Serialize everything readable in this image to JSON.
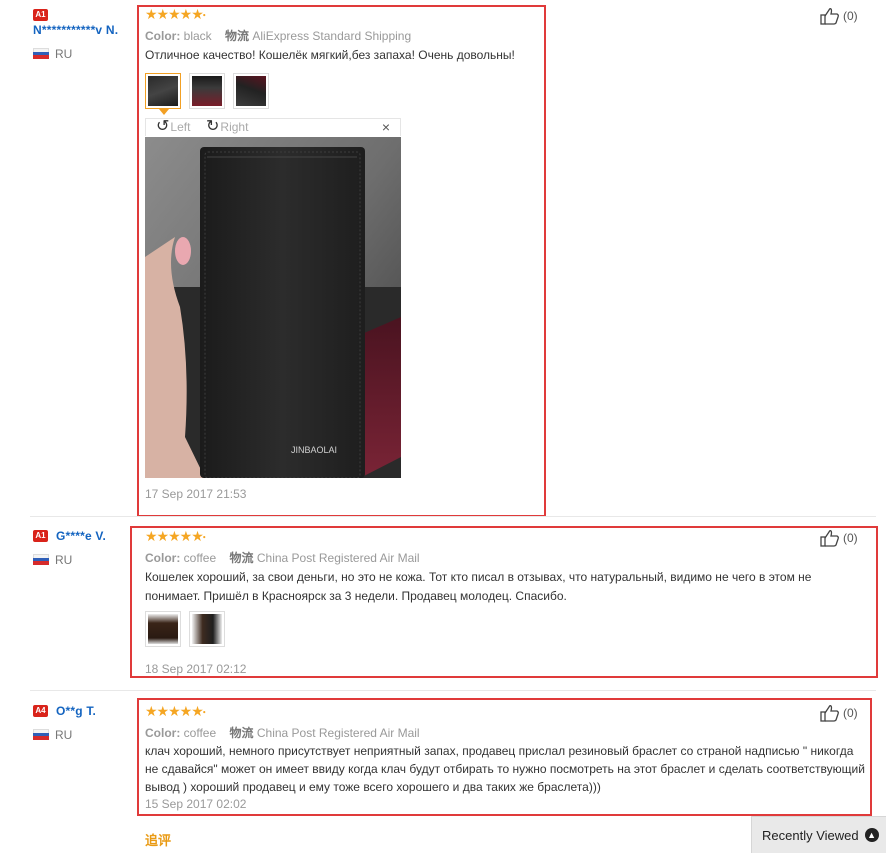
{
  "reviews": [
    {
      "badge": "A1",
      "username": "N***********v N.",
      "country": "RU",
      "rating": 5,
      "color_label": "Color:",
      "color_value": "black",
      "shipping_label": "物流",
      "shipping_value": "AliExpress Standard Shipping",
      "text": "Отличное качество! Кошелёк мягкий,без запаха! Очень довольны!",
      "photo_count": 3,
      "viewer": {
        "rotate_left": "Left",
        "rotate_right": "Right",
        "close": "×",
        "brand_on_photo": "JINBAOLAI"
      },
      "date": "17 Sep 2017 21:53",
      "likes": "(0)"
    },
    {
      "badge": "A1",
      "username": "G****e V.",
      "country": "RU",
      "rating": 5,
      "color_label": "Color:",
      "color_value": "coffee",
      "shipping_label": "物流",
      "shipping_value": "China Post Registered Air Mail",
      "text": "Кошелек хороший, за свои деньги, но это не кожа. Тот кто писал в отзывах, что натуральный, видимо не чего в этом не понимает. Пришёл в Красноярск за 3 недели. Продавец молодец. Спасибо.",
      "photo_count": 2,
      "date": "18 Sep 2017 02:12",
      "likes": "(0)"
    },
    {
      "badge": "A4",
      "username": "O**g T.",
      "country": "RU",
      "rating": 5,
      "color_label": "Color:",
      "color_value": "coffee",
      "shipping_label": "物流",
      "shipping_value": "China Post Registered Air Mail",
      "text": "клач хороший, немного присутствует неприятный запах, продавец прислал резиновый браслет со страной надписью \" никогда не сдавайся\" может он имеет ввиду когда клач будут отбирать то нужно посмотреть на этот браслет и сделать соответствующий вывод ) хороший продавец и ему тоже всего хорошего и два таких же браслета)))",
      "date": "15 Sep 2017 02:02",
      "likes": "(0)",
      "followup_label": "追评"
    }
  ],
  "recently_viewed": {
    "label": "Recently Viewed",
    "icon": "chevron-up-icon"
  },
  "colors": {
    "highlight_box": "#e03a3a",
    "star": "#f5a623",
    "username": "#1464c0",
    "badge": "#d9231a"
  }
}
